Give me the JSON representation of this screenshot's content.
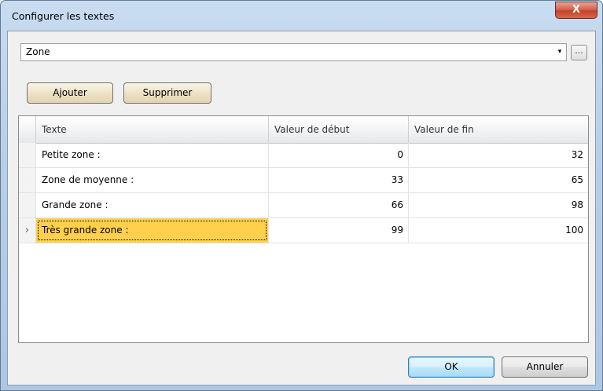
{
  "window": {
    "title": "Configurer les textes",
    "close_label": "X"
  },
  "selector": {
    "value": "Zone",
    "arrow": "▾",
    "ellipsis": "..."
  },
  "toolbar": {
    "add_label": "Ajouter",
    "delete_label": "Supprimer"
  },
  "table": {
    "columns": [
      "Texte",
      "Valeur de début",
      "Valeur de fin"
    ],
    "rows": [
      {
        "texte": "Petite zone :",
        "debut": "0",
        "fin": "32"
      },
      {
        "texte": "Zone de moyenne :",
        "debut": "33",
        "fin": "65"
      },
      {
        "texte": "Grande zone :",
        "debut": "66",
        "fin": "98"
      },
      {
        "texte": "Très grande zone :",
        "debut": "99",
        "fin": "100"
      }
    ],
    "current_row_indicator": "›"
  },
  "footer": {
    "ok_label": "OK",
    "cancel_label": "Annuler"
  }
}
